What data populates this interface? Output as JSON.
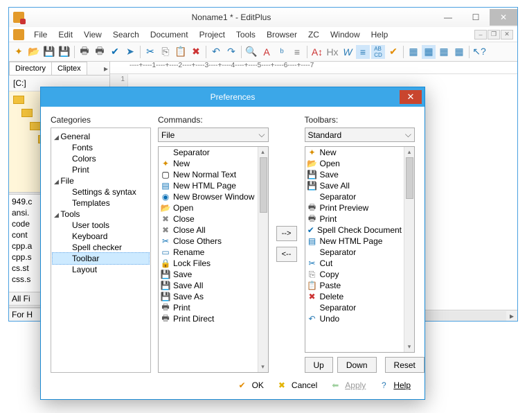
{
  "app": {
    "title": "Noname1 * - EditPlus",
    "menus": [
      "File",
      "Edit",
      "View",
      "Search",
      "Document",
      "Project",
      "Tools",
      "Browser",
      "ZC",
      "Window",
      "Help"
    ],
    "ruler": "----+----1----+----2----+----3----+----4----+----5----+----6----+----7",
    "gutter_line": "1",
    "side": {
      "tabs": [
        "Directory",
        "Cliptex"
      ],
      "drive": "[C:]",
      "files": [
        "949.c",
        "ansi.",
        "code",
        "cont",
        "cpp.a",
        "cpp.s",
        "cs.st",
        "css.s"
      ],
      "allfi": "All Fi",
      "forh": "For H"
    }
  },
  "dialog": {
    "title": "Preferences",
    "categories_label": "Categories",
    "tree": {
      "general": "General",
      "general_children": [
        "Fonts",
        "Colors",
        "Print"
      ],
      "file": "File",
      "file_children": [
        "Settings & syntax",
        "Templates"
      ],
      "tools": "Tools",
      "tools_children": [
        "User tools",
        "Keyboard",
        "Spell checker",
        "Toolbar",
        "Layout"
      ]
    },
    "commands": {
      "label": "Commands:",
      "combo": "File",
      "items": [
        {
          "icon": "",
          "cls": "",
          "t": "Separator"
        },
        {
          "icon": "✦",
          "cls": "c-new",
          "t": "New"
        },
        {
          "icon": "▢",
          "cls": "",
          "t": "New Normal Text"
        },
        {
          "icon": "▤",
          "cls": "c-html",
          "t": "New HTML Page"
        },
        {
          "icon": "◉",
          "cls": "c-html",
          "t": "New Browser Window"
        },
        {
          "icon": "📂",
          "cls": "c-open",
          "t": "Open"
        },
        {
          "icon": "✖",
          "cls": "c-close",
          "t": "Close"
        },
        {
          "icon": "✖",
          "cls": "c-close",
          "t": "Close All"
        },
        {
          "icon": "✂",
          "cls": "c-html",
          "t": "Close Others"
        },
        {
          "icon": "▭",
          "cls": "c-rename",
          "t": "Rename"
        },
        {
          "icon": "🔒",
          "cls": "c-lock",
          "t": "Lock Files"
        },
        {
          "icon": "💾",
          "cls": "c-save",
          "t": "Save"
        },
        {
          "icon": "💾",
          "cls": "c-saveall",
          "t": "Save All"
        },
        {
          "icon": "💾",
          "cls": "c-save",
          "t": "Save As"
        },
        {
          "icon": "🖶",
          "cls": "c-print",
          "t": "Print"
        },
        {
          "icon": "🖶",
          "cls": "c-print",
          "t": "Print Direct"
        }
      ]
    },
    "toolbars": {
      "label": "Toolbars:",
      "combo": "Standard",
      "items": [
        {
          "icon": "✦",
          "cls": "c-new",
          "t": "New"
        },
        {
          "icon": "📂",
          "cls": "c-open",
          "t": "Open"
        },
        {
          "icon": "💾",
          "cls": "c-save",
          "t": "Save"
        },
        {
          "icon": "💾",
          "cls": "c-saveall",
          "t": "Save All"
        },
        {
          "icon": "",
          "cls": "",
          "t": "Separator"
        },
        {
          "icon": "🖶",
          "cls": "c-print",
          "t": "Print Preview"
        },
        {
          "icon": "🖶",
          "cls": "c-print",
          "t": "Print"
        },
        {
          "icon": "✔",
          "cls": "c-spell",
          "t": "Spell Check Document"
        },
        {
          "icon": "▤",
          "cls": "c-html",
          "t": "New HTML Page"
        },
        {
          "icon": "",
          "cls": "",
          "t": "Separator"
        },
        {
          "icon": "✂",
          "cls": "c-cut",
          "t": "Cut"
        },
        {
          "icon": "⎘",
          "cls": "c-copy",
          "t": "Copy"
        },
        {
          "icon": "📋",
          "cls": "c-paste",
          "t": "Paste"
        },
        {
          "icon": "✖",
          "cls": "c-del",
          "t": "Delete"
        },
        {
          "icon": "",
          "cls": "",
          "t": "Separator"
        },
        {
          "icon": "↶",
          "cls": "c-undo",
          "t": "Undo"
        }
      ]
    },
    "move": {
      "right": "-->",
      "left": "<--"
    },
    "buttons": {
      "up": "Up",
      "down": "Down",
      "reset": "Reset"
    },
    "footer": {
      "ok": "OK",
      "cancel": "Cancel",
      "apply": "Apply",
      "help": "Help"
    }
  }
}
